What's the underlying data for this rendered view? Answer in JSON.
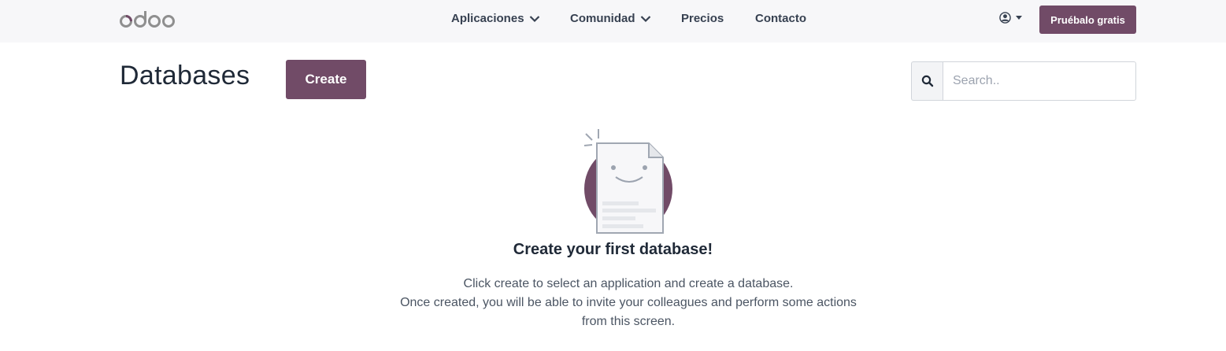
{
  "header": {
    "logo_text": "odoo",
    "nav": [
      {
        "label": "Aplicaciones",
        "has_dropdown": true
      },
      {
        "label": "Comunidad",
        "has_dropdown": true
      },
      {
        "label": "Precios",
        "has_dropdown": false
      },
      {
        "label": "Contacto",
        "has_dropdown": false
      }
    ],
    "user_icon": "user-circle-icon",
    "cta_label": "Pruébalo gratis"
  },
  "main": {
    "title": "Databases",
    "create_label": "Create",
    "search": {
      "icon": "search-icon",
      "placeholder": "Search.."
    },
    "empty_state": {
      "illustration": "smiling-document-icon",
      "heading": "Create your first database!",
      "lines": [
        "Click create to select an application and create a database.",
        "Once created, you will be able to invite your colleagues and perform some actions",
        "from this screen."
      ]
    }
  },
  "colors": {
    "brand": "#714b67",
    "topbar_bg": "#f7f7f9"
  }
}
